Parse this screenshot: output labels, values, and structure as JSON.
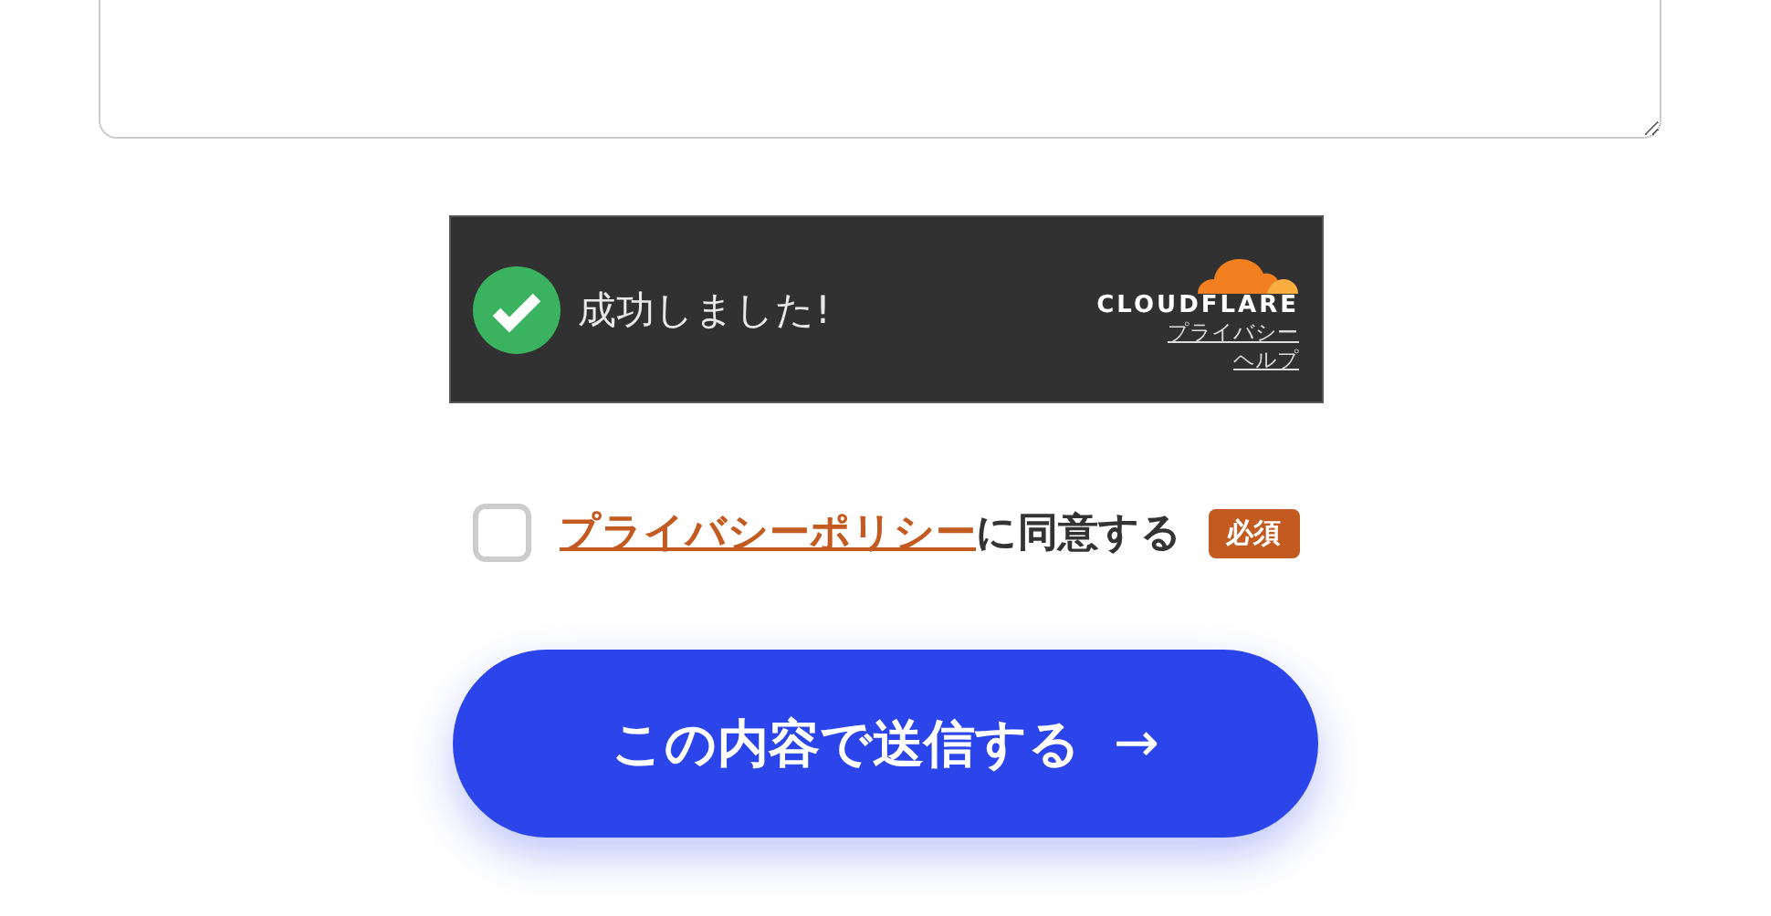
{
  "captcha": {
    "status": "成功しました!",
    "success": true,
    "brand": "CLOUDFLARE",
    "links": [
      "プライバシー",
      "ヘルプ"
    ]
  },
  "consent": {
    "checked": false,
    "link": "プライバシーポリシー",
    "text": "に同意する",
    "badge": "必須"
  },
  "submit": {
    "label": "この内容で送信する",
    "arrow": "→"
  }
}
